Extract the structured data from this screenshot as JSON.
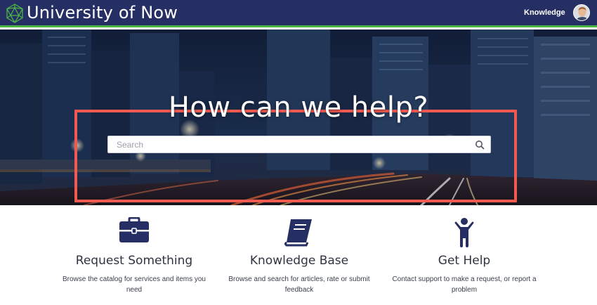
{
  "header": {
    "brand": "University of Now",
    "nav": {
      "knowledge": "Knowledge"
    },
    "accent_bar_color": "#4bb543",
    "background_color": "#262f63"
  },
  "hero": {
    "title": "How can we help?",
    "search": {
      "placeholder": "Search",
      "value": ""
    },
    "highlight_color": "#f05a50"
  },
  "cards": [
    {
      "title": "Request Something",
      "description": "Browse the catalog for services and items you need",
      "icon": "briefcase-icon"
    },
    {
      "title": "Knowledge Base",
      "description": "Browse and search for articles, rate or submit feedback",
      "icon": "book-icon"
    },
    {
      "title": "Get Help",
      "description": "Contact support to make a request, or report a problem",
      "icon": "person-icon"
    }
  ],
  "icon_color": "#262f63"
}
